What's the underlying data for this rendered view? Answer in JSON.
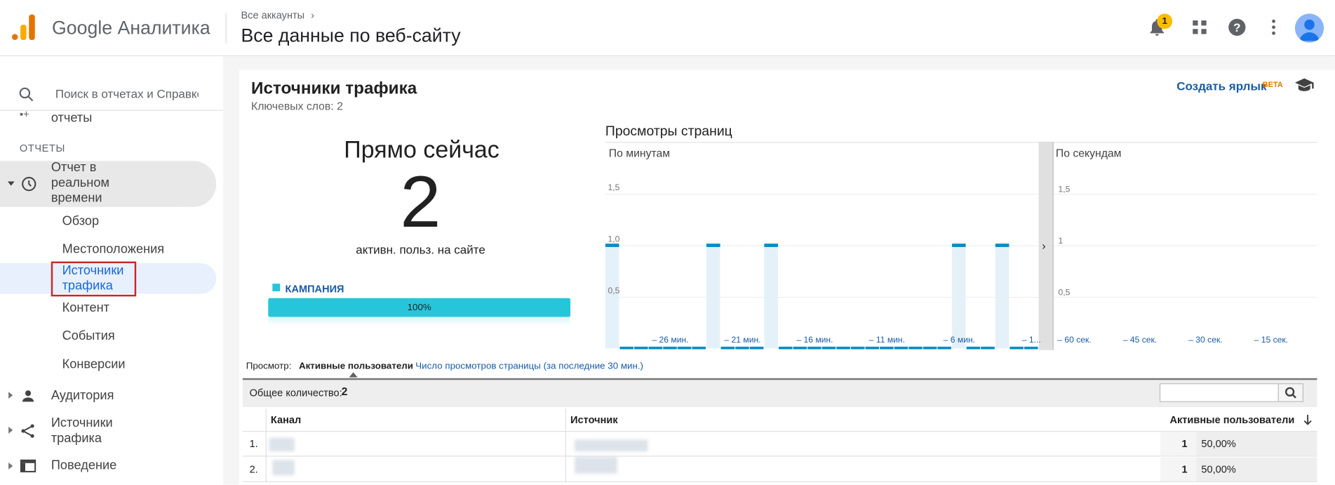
{
  "header": {
    "app_title": "Google Аналитика",
    "breadcrumb": "Все аккаунты",
    "view_title": "Все данные по веб-сайту",
    "notifications_count": "1"
  },
  "sidebar": {
    "search_placeholder": "Поиск в отчетах и Справке",
    "item_reports_partial": "отчеты",
    "section_label": "ОТЧЕТЫ",
    "realtime_label": "Отчет в реальном времени",
    "realtime_sub": [
      "Обзор",
      "Местоположения",
      "Источники трафика",
      "Контент",
      "События",
      "Конверсии"
    ],
    "audience": "Аудитория",
    "acquisition": "Источники трафика",
    "behavior": "Поведение"
  },
  "page": {
    "title": "Источники трафика",
    "keywords": "Ключевых слов: 2",
    "create_shortcut": "Создать ярлык",
    "beta": "BETA"
  },
  "right_now": {
    "title": "Прямо сейчас",
    "count": "2",
    "caption": "активн. польз. на сайте",
    "legend": "КАМПАНИЯ",
    "bar_label": "100%",
    "bar_fraction": 1.0
  },
  "pageviews": {
    "title": "Просмотры страниц",
    "per_minute_label": "По минутам",
    "per_second_label": "По секундам"
  },
  "chart_data": [
    {
      "type": "bar",
      "title": "По минутам",
      "ylim": [
        0,
        2
      ],
      "yticks": [
        "1,5",
        "1,0",
        "0,5"
      ],
      "xticks": [
        "– 26 мин.",
        "– 21 мин.",
        "– 16 мин.",
        "– 11 мин.",
        "– 6 мин.",
        "– 1..."
      ],
      "x": [
        -30,
        -29,
        -28,
        -27,
        -26,
        -25,
        -24,
        -23,
        -22,
        -21,
        -20,
        -19,
        -18,
        -17,
        -16,
        -15,
        -14,
        -13,
        -12,
        -11,
        -10,
        -9,
        -8,
        -7,
        -6,
        -5,
        -4,
        -3,
        -2,
        -1
      ],
      "values": [
        1,
        0,
        0,
        0,
        0,
        0,
        0,
        1,
        0,
        0,
        0,
        1,
        0,
        0,
        0,
        0,
        0,
        0,
        0,
        0,
        0,
        0,
        0,
        0,
        1,
        0,
        0,
        1,
        0,
        0
      ]
    },
    {
      "type": "bar",
      "title": "По секундам",
      "ylim": [
        0,
        2
      ],
      "yticks": [
        "1,5",
        "1",
        "0,5"
      ],
      "xticks": [
        "– 60 сек.",
        "– 45 сек.",
        "– 30 сек.",
        "– 15 сек."
      ],
      "values": []
    }
  ],
  "view_toggle": {
    "label": "Просмотр:",
    "active": "Активные пользователи",
    "other": "Число просмотров страницы (за последние 30 мин.)"
  },
  "table": {
    "total_label": "Общее количество:",
    "total_value": "2",
    "columns": [
      "Канал",
      "Источник",
      "Активные пользователи"
    ],
    "rows": [
      {
        "num": "1.",
        "value": "1",
        "pct": "50,00%"
      },
      {
        "num": "2.",
        "value": "1",
        "pct": "50,00%"
      }
    ]
  },
  "colors": {
    "accent_blue": "#1a5ba6",
    "bar_cyan": "#26c6da",
    "chart_bar": "#058dc7",
    "active_nav": "#1967d2",
    "highlight_red": "#c62828"
  }
}
